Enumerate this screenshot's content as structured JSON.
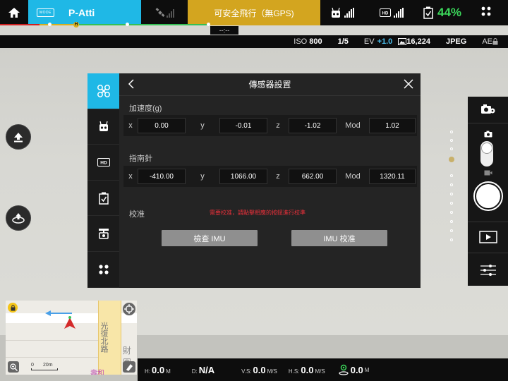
{
  "topbar": {
    "mode_badge": "MODE",
    "flight_mode": "P-Atti",
    "status_text": "可安全飛行（無GPS)",
    "battery_percent": "44%",
    "countdown": "--:--"
  },
  "camera_bar": {
    "iso_label": "ISO",
    "iso_value": "800",
    "shutter": "1/5",
    "ev_label": "EV",
    "ev_value": "+1.0",
    "photos_left": "16,224",
    "format": "JPEG",
    "ae_label": "AE"
  },
  "dialog": {
    "title": "傳感器設置",
    "accel_title": "加速度(g)",
    "accel": {
      "x": "0.00",
      "y": "-0.01",
      "z": "-1.02",
      "mod": "1.02"
    },
    "compass_title": "指南針",
    "compass": {
      "x": "-410.00",
      "y": "1066.00",
      "z": "662.00",
      "mod": "1320.11"
    },
    "axis_x": "x",
    "axis_y": "y",
    "axis_z": "z",
    "axis_mod": "Mod",
    "calib_label": "校准",
    "calib_warning": "需要校准，請點擊相應的按鈕進行校準",
    "check_imu_button": "檢查 IMU",
    "imu_calib_button": "IMU 校准"
  },
  "map": {
    "street": "光復北路",
    "poi": "財團",
    "poi2": "壽和",
    "scale_0": "0",
    "scale_20": "20m"
  },
  "telemetry": {
    "h_label": "H:",
    "h_value": "0.0",
    "h_unit": "M",
    "d_label": "D:",
    "d_value": "N/A",
    "vs_label": "V.S:",
    "vs_value": "0.0",
    "vs_unit": "M/S",
    "hs_label": "H.S:",
    "hs_value": "0.0",
    "hs_unit": "M/S",
    "alt_value": "0.0",
    "alt_unit": "M"
  },
  "colors": {
    "accent": "#1fb8e6",
    "warning": "#d3a51f",
    "battery": "#3bd65a",
    "error": "#e8303a"
  }
}
